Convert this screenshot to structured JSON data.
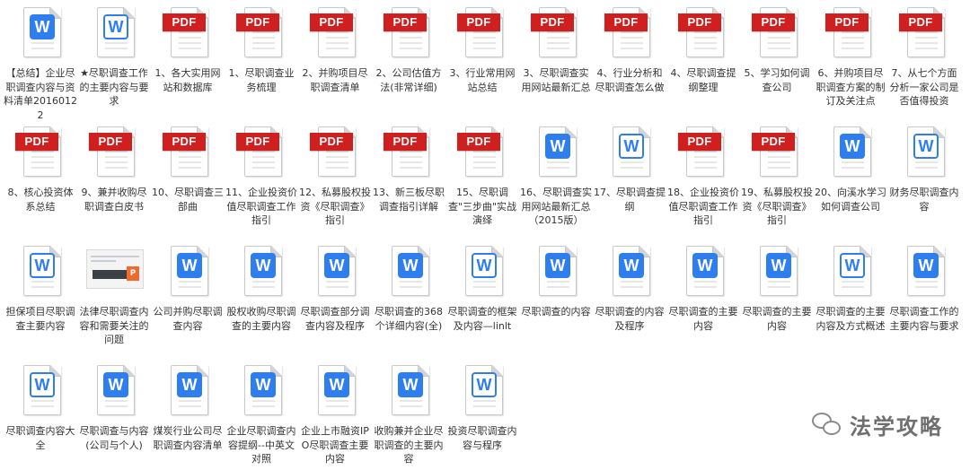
{
  "files": [
    {
      "type": "word",
      "label": "【总结】企业尽职调查内容与资料清单20160122"
    },
    {
      "type": "word-outline",
      "label": "★尽职调查工作的主要内容与要求"
    },
    {
      "type": "pdf",
      "label": "1、各大实用网站和数据库"
    },
    {
      "type": "pdf",
      "label": "1、尽职调查业务梳理"
    },
    {
      "type": "pdf",
      "label": "2、并购项目尽职调查清单"
    },
    {
      "type": "pdf",
      "label": "2、公司估值方法(非常详细)"
    },
    {
      "type": "pdf",
      "label": "3、行业常用网站总结"
    },
    {
      "type": "pdf",
      "label": "3、尽职调查实用网站最新汇总"
    },
    {
      "type": "pdf",
      "label": "4、行业分析和尽职调查怎么做"
    },
    {
      "type": "pdf",
      "label": "4、尽职调查提纲整理"
    },
    {
      "type": "pdf",
      "label": "5、学习如何调查公司"
    },
    {
      "type": "pdf",
      "label": "6、并购项目尽职调查方案的制订及关注点"
    },
    {
      "type": "pdf",
      "label": "7、从七个方面分析一家公司是否值得投资"
    },
    {
      "type": "pdf",
      "label": "8、核心投资体系总结"
    },
    {
      "type": "pdf",
      "label": "9、兼并收购尽职调查白皮书"
    },
    {
      "type": "pdf",
      "label": "10、尽职调查三部曲"
    },
    {
      "type": "pdf",
      "label": "11、企业投资价值尽职调查工作指引"
    },
    {
      "type": "pdf",
      "label": "12、私募股权投资《尽职调查》指引"
    },
    {
      "type": "pdf",
      "label": "13、新三板尽职调查指引详解"
    },
    {
      "type": "pdf",
      "label": "15、尽职调查\"三步曲\"实战演绎"
    },
    {
      "type": "word",
      "label": "16、尽职调查实用网站最新汇总（2015版）"
    },
    {
      "type": "word-outline",
      "label": "17、尽职调查提纲"
    },
    {
      "type": "pdf",
      "label": "18、企业投资价值尽职调查工作指引"
    },
    {
      "type": "pdf",
      "label": "19、私募股权投资《尽职调查》指引"
    },
    {
      "type": "word",
      "label": "20、向溪水学习如何调查公司"
    },
    {
      "type": "word-outline",
      "label": "财务尽职调查内容"
    },
    {
      "type": "word-outline",
      "label": "担保项目尽职调查主要内容"
    },
    {
      "type": "thumb",
      "label": "法律尽职调查内容和需要关注的问题"
    },
    {
      "type": "word",
      "label": "公司并购尽职调查内容"
    },
    {
      "type": "word",
      "label": "股权收购尽职调查的主要内容"
    },
    {
      "type": "word",
      "label": "尽职调查部分调查内容及程序"
    },
    {
      "type": "word",
      "label": "尽职调查的368个详细内容(全)"
    },
    {
      "type": "word-outline",
      "label": "尽职调查的框架及内容—linlt"
    },
    {
      "type": "word",
      "label": "尽职调查的内容"
    },
    {
      "type": "word",
      "label": "尽职调查的内容及程序"
    },
    {
      "type": "word",
      "label": "尽职调查的主要内容"
    },
    {
      "type": "word",
      "label": "尽职调查的主要内容"
    },
    {
      "type": "word-outline",
      "label": "尽职调查的主要内容及方式概述"
    },
    {
      "type": "word",
      "label": "尽职调查工作的主要内容与要求"
    },
    {
      "type": "word-outline",
      "label": "尽职调查内容大全"
    },
    {
      "type": "word",
      "label": "尽职调查与内容(公司与个人)"
    },
    {
      "type": "word",
      "label": "煤炭行业公司尽职调查内容清单"
    },
    {
      "type": "word",
      "label": "企业尽职调查内容提纲--中英文对照"
    },
    {
      "type": "word",
      "label": "企业上市融资IPO尽职调查主要内容"
    },
    {
      "type": "word",
      "label": "收购兼并企业尽职调查的主要内容"
    },
    {
      "type": "word-outline",
      "label": "投资尽职调查内容与程序"
    }
  ],
  "icons": {
    "pdf_text": "PDF",
    "word_text": "W",
    "thumb_badge": "P"
  },
  "colors": {
    "pdf": "#cf1f1f",
    "word": "#2f7ef0"
  },
  "brand": {
    "name": "法学攻略",
    "icon": "wechat-icon"
  }
}
